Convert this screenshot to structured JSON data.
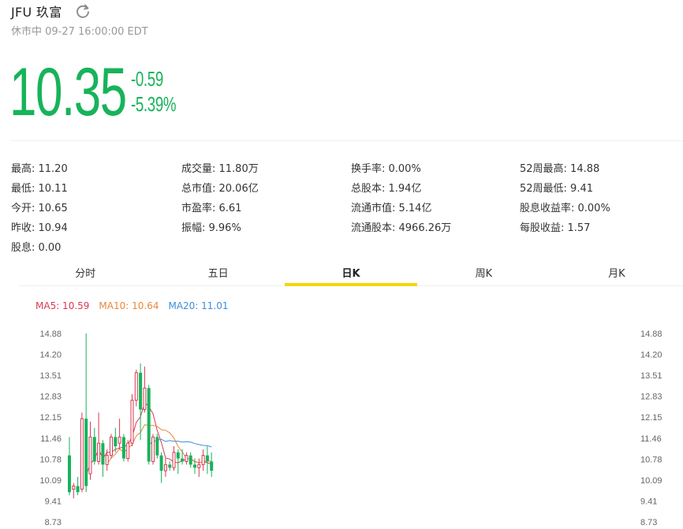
{
  "header": {
    "title": "JFU 玖富",
    "refresh_icon": "refresh-icon"
  },
  "status": "休市中 09-27 16:00:00 EDT",
  "quote": {
    "price": "10.35",
    "change": "-0.59",
    "change_pct": "-5.39%",
    "color": "#17b35a"
  },
  "stats": [
    [
      "最高: 11.20",
      "成交量: 11.80万",
      "换手率: 0.00%",
      "52周最高: 14.88"
    ],
    [
      "最低: 10.11",
      "总市值: 20.06亿",
      "总股本: 1.94亿",
      "52周最低: 9.41"
    ],
    [
      "今开: 10.65",
      "市盈率: 6.61",
      "流通市值: 5.14亿",
      "股息收益率: 0.00%"
    ],
    [
      "昨收: 10.94",
      "振幅: 9.96%",
      "流通股本: 4966.26万",
      "每股收益: 1.57"
    ],
    [
      "股息: 0.00"
    ]
  ],
  "tabs": [
    {
      "label": "分时",
      "active": false
    },
    {
      "label": "五日",
      "active": false
    },
    {
      "label": "日K",
      "active": true
    },
    {
      "label": "周K",
      "active": false
    },
    {
      "label": "月K",
      "active": false
    }
  ],
  "legend": {
    "ma5": "MA5: 10.59",
    "ma10": "MA10: 10.64",
    "ma20": "MA20: 11.01"
  },
  "colors": {
    "up": "#d93a54",
    "down": "#17b35a",
    "ma5": "#d93a54",
    "ma10": "#e8883a",
    "ma20": "#3a8fd9",
    "accent": "#f5d60a"
  },
  "chart_data": {
    "type": "candlestick",
    "y_ticks": [
      "14.88",
      "14.20",
      "13.51",
      "12.83",
      "12.15",
      "11.46",
      "10.78",
      "10.09",
      "9.41",
      "8.73"
    ],
    "ylim": [
      8.73,
      14.88
    ],
    "candles": [
      {
        "o": 10.9,
        "c": 9.7,
        "h": 11.5,
        "l": 9.6
      },
      {
        "o": 9.8,
        "c": 9.9,
        "h": 10.0,
        "l": 9.5
      },
      {
        "o": 9.9,
        "c": 9.7,
        "h": 10.2,
        "l": 9.6
      },
      {
        "o": 9.8,
        "c": 12.1,
        "h": 12.3,
        "l": 9.7
      },
      {
        "o": 12.1,
        "c": 9.9,
        "h": 14.88,
        "l": 9.7
      },
      {
        "o": 10.3,
        "c": 11.5,
        "h": 12.0,
        "l": 10.1
      },
      {
        "o": 11.5,
        "c": 10.7,
        "h": 11.8,
        "l": 10.6
      },
      {
        "o": 10.7,
        "c": 11.3,
        "h": 12.3,
        "l": 10.6
      },
      {
        "o": 11.3,
        "c": 10.6,
        "h": 11.4,
        "l": 10.2
      },
      {
        "o": 10.6,
        "c": 10.9,
        "h": 11.1,
        "l": 10.4
      },
      {
        "o": 10.9,
        "c": 11.5,
        "h": 11.6,
        "l": 10.8
      },
      {
        "o": 11.5,
        "c": 11.2,
        "h": 11.8,
        "l": 11.0
      },
      {
        "o": 11.3,
        "c": 11.5,
        "h": 12.1,
        "l": 11.1
      },
      {
        "o": 11.5,
        "c": 10.8,
        "h": 11.6,
        "l": 10.7
      },
      {
        "o": 10.8,
        "c": 11.3,
        "h": 11.4,
        "l": 10.7
      },
      {
        "o": 11.3,
        "c": 12.7,
        "h": 12.9,
        "l": 11.2
      },
      {
        "o": 12.7,
        "c": 13.6,
        "h": 13.7,
        "l": 12.5
      },
      {
        "o": 13.6,
        "c": 12.4,
        "h": 13.9,
        "l": 11.4
      },
      {
        "o": 12.4,
        "c": 13.1,
        "h": 13.8,
        "l": 12.3
      },
      {
        "o": 13.1,
        "c": 10.7,
        "h": 13.2,
        "l": 10.6
      },
      {
        "o": 10.7,
        "c": 11.5,
        "h": 11.6,
        "l": 10.6
      },
      {
        "o": 11.5,
        "c": 10.9,
        "h": 11.6,
        "l": 10.8
      },
      {
        "o": 10.9,
        "c": 10.4,
        "h": 11.0,
        "l": 10.0
      },
      {
        "o": 10.4,
        "c": 10.6,
        "h": 10.8,
        "l": 10.2
      },
      {
        "o": 10.6,
        "c": 10.5,
        "h": 10.7,
        "l": 10.4
      },
      {
        "o": 10.5,
        "c": 11.0,
        "h": 11.2,
        "l": 10.4
      },
      {
        "o": 11.0,
        "c": 10.8,
        "h": 11.1,
        "l": 10.3
      },
      {
        "o": 10.8,
        "c": 10.7,
        "h": 11.1,
        "l": 10.6
      },
      {
        "o": 10.7,
        "c": 10.9,
        "h": 11.0,
        "l": 10.6
      },
      {
        "o": 10.9,
        "c": 10.6,
        "h": 11.0,
        "l": 10.5
      },
      {
        "o": 10.6,
        "c": 10.5,
        "h": 10.8,
        "l": 10.3
      },
      {
        "o": 10.5,
        "c": 10.6,
        "h": 10.8,
        "l": 10.2
      },
      {
        "o": 10.6,
        "c": 10.9,
        "h": 11.1,
        "l": 10.4
      },
      {
        "o": 10.9,
        "c": 10.7,
        "h": 11.2,
        "l": 10.3
      },
      {
        "o": 10.7,
        "c": 10.4,
        "h": 11.0,
        "l": 10.2
      }
    ]
  }
}
